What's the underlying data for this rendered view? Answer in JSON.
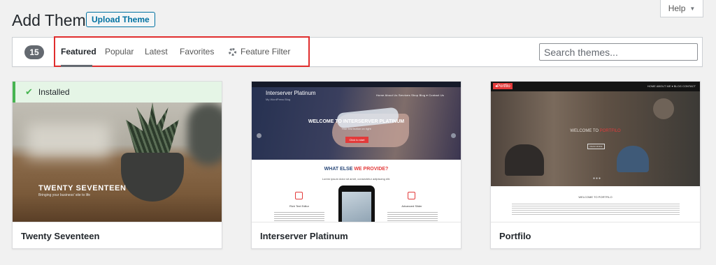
{
  "header": {
    "title": "Add Themes",
    "upload_label": "Upload Theme",
    "help_label": "Help"
  },
  "filter_bar": {
    "count": "15",
    "tabs": [
      {
        "label": "Featured"
      },
      {
        "label": "Popular"
      },
      {
        "label": "Latest"
      },
      {
        "label": "Favorites"
      },
      {
        "label": "Feature Filter"
      }
    ],
    "search_placeholder": "Search themes..."
  },
  "themes": [
    {
      "name": "Twenty Seventeen",
      "installed_label": "Installed",
      "preview": {
        "brand": "TWENTY SEVENTEEN",
        "tagline": "Bringing your business' site to life"
      }
    },
    {
      "name": "Interserver Platinum",
      "preview": {
        "brand": "Interserver Platinum",
        "sub": "My WordPress Blog",
        "nav": "Home   About Us   Services   Shop   Blog ▾   Contact Us",
        "welcome": "WELCOME TO INTERSERVER PLATINUM",
        "welcome_sub": "Your first button on right",
        "button": "Click to start",
        "what_a": "WHAT ELSE ",
        "what_b": "WE PROVIDE?",
        "lorem": "Lorem ipsum dolor sit amet, consectetur adipiscing elit.",
        "feature1": "Rich Text Editor",
        "feature2": "Advanced Slider"
      }
    },
    {
      "name": "Portfilo",
      "preview": {
        "logo": "◂Portfilo",
        "nav": "HOME   ABOUT ME ▾   BLOG   CONTACT",
        "welcome_a": "WELCOME TO ",
        "welcome_b": "PORTFILO",
        "button": "READ MORE",
        "section_title": "WELCOME TO PORTFILO"
      }
    }
  ],
  "colors": {
    "accent": "#0071a1",
    "installed_green": "#46b450",
    "highlight_red": "#e02d2d"
  }
}
